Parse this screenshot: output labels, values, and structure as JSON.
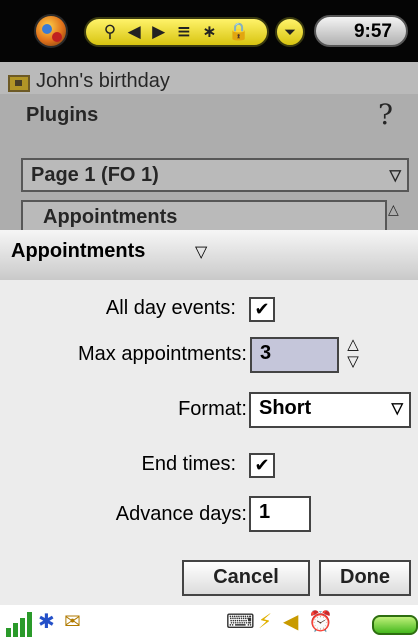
{
  "statusbar": {
    "time": "9:57",
    "icons": [
      "search-icon",
      "arrow-left-icon",
      "arrow-right-icon",
      "list-icon",
      "bluetooth-icon",
      "lock-icon"
    ],
    "icon_glyphs": [
      "⚲",
      "◀",
      "▶",
      "≡",
      "∗",
      "🔒"
    ],
    "menu_glyph": "⏷"
  },
  "background_app": {
    "today_text": "John's birthday",
    "plugins_title": "Plugins",
    "help_glyph": "?",
    "page_dropdown": "Page 1 (FO 1)",
    "item_label": "Appointments"
  },
  "panel": {
    "title": "Appointments",
    "fields": {
      "all_day": {
        "label": "All day events:",
        "checked": true,
        "mark": "✔"
      },
      "max_appointments": {
        "label": "Max appointments:",
        "value": "3"
      },
      "format": {
        "label": "Format:",
        "value": "Short"
      },
      "end_times": {
        "label": "End times:",
        "checked": true,
        "mark": "✔"
      },
      "advance_days": {
        "label": "Advance days:",
        "value": "1"
      }
    },
    "buttons": {
      "cancel": "Cancel",
      "done": "Done"
    }
  },
  "tray": {
    "icons": [
      "signal-icon",
      "bluetooth-icon",
      "mail-icon",
      "keyboard-icon",
      "charging-icon",
      "volume-icon",
      "alarm-icon",
      "battery-icon"
    ]
  },
  "colors": {
    "topbar": "#050505",
    "accent_yellow": "#f0e040",
    "active_field": "#c5c6da",
    "battery_green": "#45b81e"
  }
}
